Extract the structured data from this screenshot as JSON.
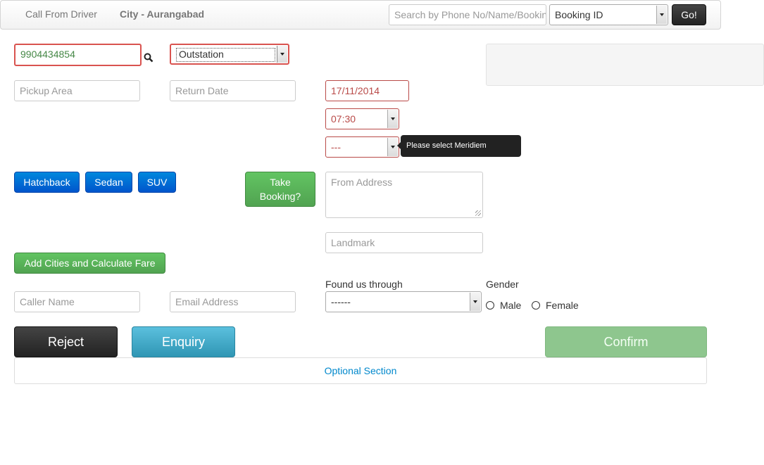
{
  "navbar": {
    "call_from_driver": "Call From Driver",
    "city": "City - Aurangabad",
    "search_placeholder": "Search by Phone No/Name/Booking",
    "search_type": "Booking ID",
    "go_label": "Go!"
  },
  "form": {
    "phone_value": "9904434854",
    "trip_type": "Outstation",
    "pickup_area_placeholder": "Pickup Area",
    "return_date_placeholder": "Return Date",
    "pickup_date_value": "17/11/2014",
    "pickup_time_value": "07:30",
    "meridiem_value": "---",
    "meridiem_tooltip": "Please select Meridiem indicator",
    "car_types": [
      "Hatchback",
      "Sedan",
      "SUV"
    ],
    "take_booking_label": "Take Booking?",
    "from_address_placeholder": "From Address",
    "landmark_placeholder": "Landmark",
    "add_cities_label": "Add Cities and Calculate Fare",
    "caller_name_placeholder": "Caller Name",
    "email_placeholder": "Email Address",
    "found_us_label": "Found us through",
    "found_us_value": "------",
    "gender_label": "Gender",
    "gender_male": "Male",
    "gender_female": "Female"
  },
  "actions": {
    "reject": "Reject",
    "enquiry": "Enquiry",
    "confirm": "Confirm",
    "optional_section": "Optional Section"
  }
}
